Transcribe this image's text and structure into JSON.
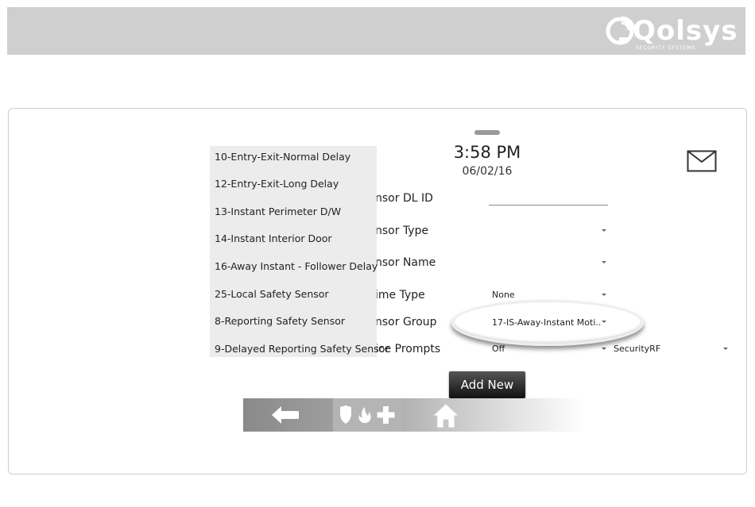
{
  "brand": {
    "name": "Qolsys",
    "tagline": "SECURITY SYSTEMS"
  },
  "status": {
    "time": "3:58 PM",
    "date": "06/02/16"
  },
  "form": {
    "fields": [
      {
        "label": "nsor DL ID",
        "value": ""
      },
      {
        "label": "nsor Type",
        "value": ""
      },
      {
        "label": "nsor Name",
        "value": ""
      },
      {
        "label": "ime Type",
        "value": "None"
      },
      {
        "label": "nsor Group",
        "value": "17-IS-Away-Instant Moti.."
      },
      {
        "label": "ice Prompts",
        "value": "Off"
      }
    ],
    "extra_select": "SecurityRF",
    "add_button": "Add New"
  },
  "group_dropdown": {
    "options": [
      "10-Entry-Exit-Normal Delay",
      "12-Entry-Exit-Long Delay",
      "13-Instant Perimeter D/W",
      "14-Instant Interior Door",
      "16-Away Instant - Follower Delay",
      "25-Local Safety Sensor",
      "8-Reporting Safety Sensor",
      "9-Delayed Reporting Safety Sensor"
    ]
  },
  "navbar": {
    "icons": [
      "back-arrow-icon",
      "shield-icon",
      "fire-icon",
      "medical-cross-icon",
      "home-icon"
    ]
  },
  "colors": {
    "header_bg": "#cfcfcf",
    "dropdown_bg": "#ececec",
    "button_bg": "#222222"
  }
}
